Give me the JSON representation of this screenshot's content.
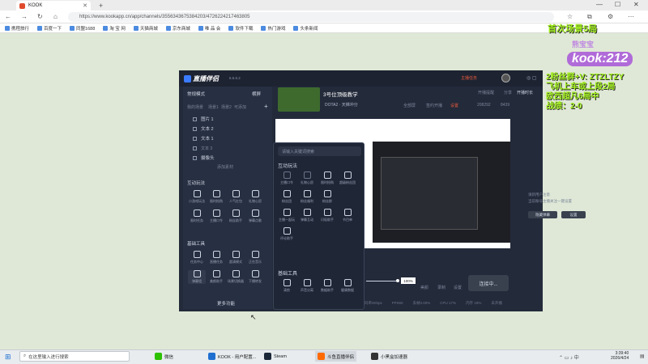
{
  "browser": {
    "tab_title": "KOOK",
    "url": "https://www.kookapp.cn/app/channels/3556343675384203/4726224217463805",
    "bookmarks": [
      "携程旅行",
      "百度一下",
      "同盟1688",
      "淘 宝 网",
      "天猫商城",
      "京东商城",
      "唯 品 会",
      "软件下载",
      "热门游戏",
      "头条新闻"
    ]
  },
  "app": {
    "title": "直播伴侣",
    "version": "6.5.6.2",
    "top_right": {
      "badge": "主播任务",
      "help": "开播提醒",
      "share": "分享"
    },
    "left": {
      "mode_label": "常规模式",
      "landscape": "横屏",
      "portrait": "竖屏",
      "scene_label": "我的场景",
      "scene_tabs": [
        "场景1",
        "场景2",
        "可添加"
      ],
      "scenes": [
        "图片 1",
        "文本 2",
        "文本 1",
        "文本 3",
        "摄像头"
      ],
      "add_material": "添加素材",
      "interaction_title": "互动玩法",
      "interaction_tools": [
        "小游戏玩法",
        "限时抢购",
        "人气红包",
        "礼物心愿",
        "限时任务",
        "主播口令",
        "粉丝助手",
        "弹幕点歌"
      ],
      "basic_title": "基础工具",
      "basic_tools": [
        "任务中心",
        "直播任务",
        "超清模式",
        "正在音乐",
        "弹幕墙",
        "美颜助手",
        "场景切换器",
        "下播转发"
      ],
      "more_features": "更多功能"
    },
    "stream": {
      "title": "3号位顶级教学",
      "game": "DOTA2 · 天梯冲分",
      "tabs": [
        "全部屏",
        "签约开播",
        "设置"
      ],
      "followers": "208292",
      "viewers": "8439"
    },
    "dropdown": {
      "search_placeholder": "请输入关键词搜索",
      "section1": "互动玩法",
      "section1_items": [
        "主播口令",
        "礼物心愿",
        "限时抢购",
        "超级粉丝团",
        "粉丝团",
        "粉丝福利",
        "粉丝群",
        "主播一起玩",
        "弹幕互动",
        "闪现助手",
        "节目单",
        "评论助手"
      ],
      "section2": "基础工具",
      "section2_items": [
        "清剪",
        "声音分离",
        "数据助手",
        "健康数据",
        "更多"
      ]
    },
    "right": {
      "record": "开播时长",
      "duration": "/120",
      "notice": "请新用户注意",
      "notice2": "当前账号主播关注一键设置",
      "btn_hide": "隐藏弹幕",
      "btn_settings": "设置"
    },
    "bottom": {
      "volume": "100%",
      "controls": [
        "美颜",
        "录制",
        "设置"
      ],
      "start": "连接中...",
      "status": [
        "码率0Kbps",
        "FPS60",
        "丢帧0.00%",
        "CPU 17%",
        "内存 18%",
        "未开播"
      ]
    }
  },
  "overlay": {
    "top_text": "首次场景5局",
    "kook_sub": "熊宝宝",
    "kook_logo": "kook:212",
    "lines": [
      "2粉丝群+V: ZTZLTZY",
      "飞机上车或上段2局",
      "欧西超凡6局中",
      "战绩：2-0"
    ]
  },
  "taskbar": {
    "search": "在这里输入进行搜索",
    "apps": [
      "微信",
      "KOOK - 用户配置...",
      "Steam",
      "斗鱼直播伴侣",
      "小黑盒加速器"
    ],
    "time": "3:39:40",
    "date": "2026/4/24"
  },
  "colors": {
    "accent": "#a4f21f",
    "app_bg": "#232a3a",
    "brand": "#3a7bff"
  }
}
